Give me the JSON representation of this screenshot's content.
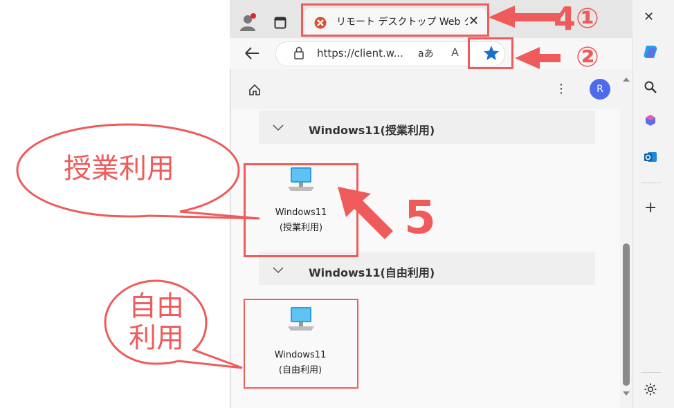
{
  "browser": {
    "tab_title": "リモート デスクトップ Web クライアント",
    "tab_close": "✕",
    "window_close": "✕",
    "url": "https://client.w...",
    "read_aloud": "aあ",
    "text_size": "A"
  },
  "toolbar": {
    "more": "⋮",
    "avatar_letter": "R"
  },
  "groups": [
    {
      "title": "Windows11(授業利用)",
      "card_line1": "Windows11",
      "card_line2": "(授業利用)"
    },
    {
      "title": "Windows11(自由利用)",
      "card_line1": "Windows11",
      "card_line2": "(自由利用)"
    }
  ],
  "annotations": {
    "step4": "4",
    "step4_circle": "①",
    "step4_circle2": "②",
    "step5": "5",
    "callout1": "授業利用",
    "callout2_line1": "自由",
    "callout2_line2": "利用"
  },
  "sidebar": {
    "add": "+"
  },
  "colors": {
    "accent_red": "#ef5a5a",
    "star_blue": "#1a73c9",
    "avatar": "#4f6bed"
  }
}
